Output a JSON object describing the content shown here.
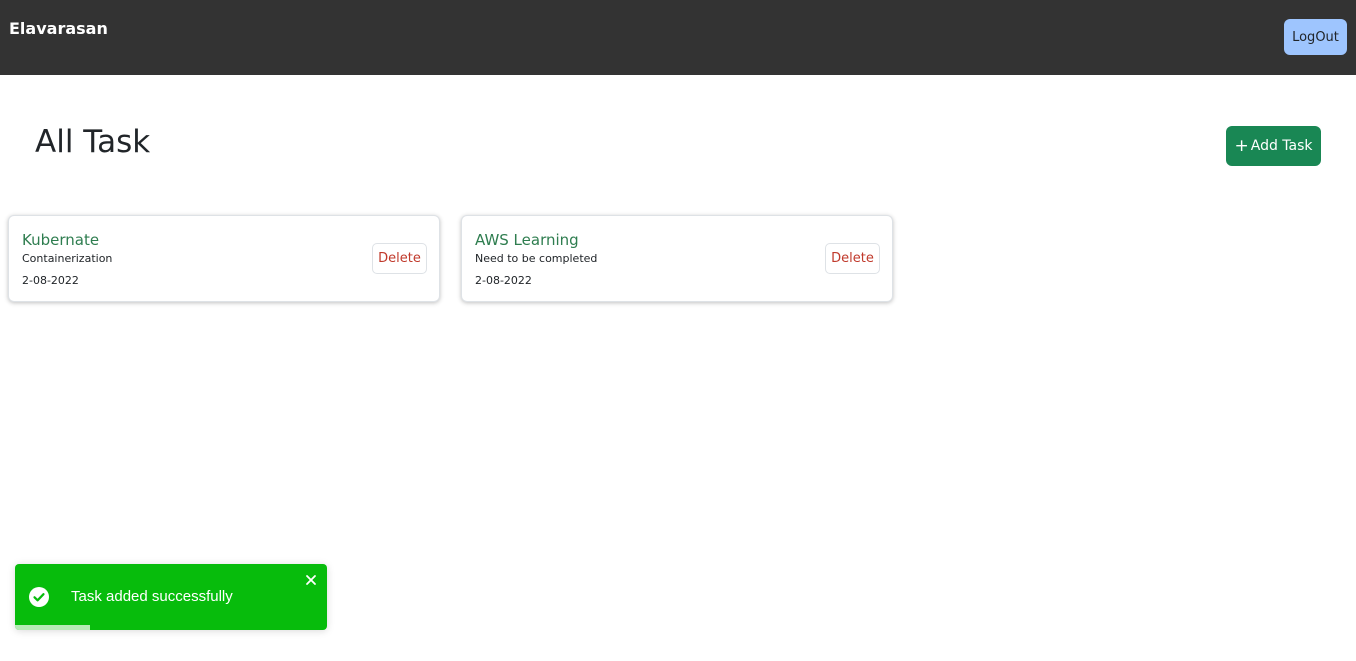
{
  "navbar": {
    "brand": "Elavarasan",
    "logout_label": "LogOut"
  },
  "main": {
    "title": "All Task",
    "add_label": "Add Task",
    "add_icon": "plus-icon"
  },
  "tasks": [
    {
      "title": "Kubernate",
      "description": "Containerization",
      "date": "2-08-2022",
      "delete_label": "Delete"
    },
    {
      "title": "AWS Learning",
      "description": "Need to be completed",
      "date": "2-08-2022",
      "delete_label": "Delete"
    }
  ],
  "toast": {
    "message": "Task added successfully",
    "icon": "check-circle-icon",
    "close_icon": "close-icon",
    "progress": 0.24
  },
  "colors": {
    "navbar": "#333333",
    "logout": "#9ec5fe",
    "add_button": "#198754",
    "task_title": "#2e7d4f",
    "delete_text": "#c0392b",
    "toast": "#07bc0c"
  }
}
